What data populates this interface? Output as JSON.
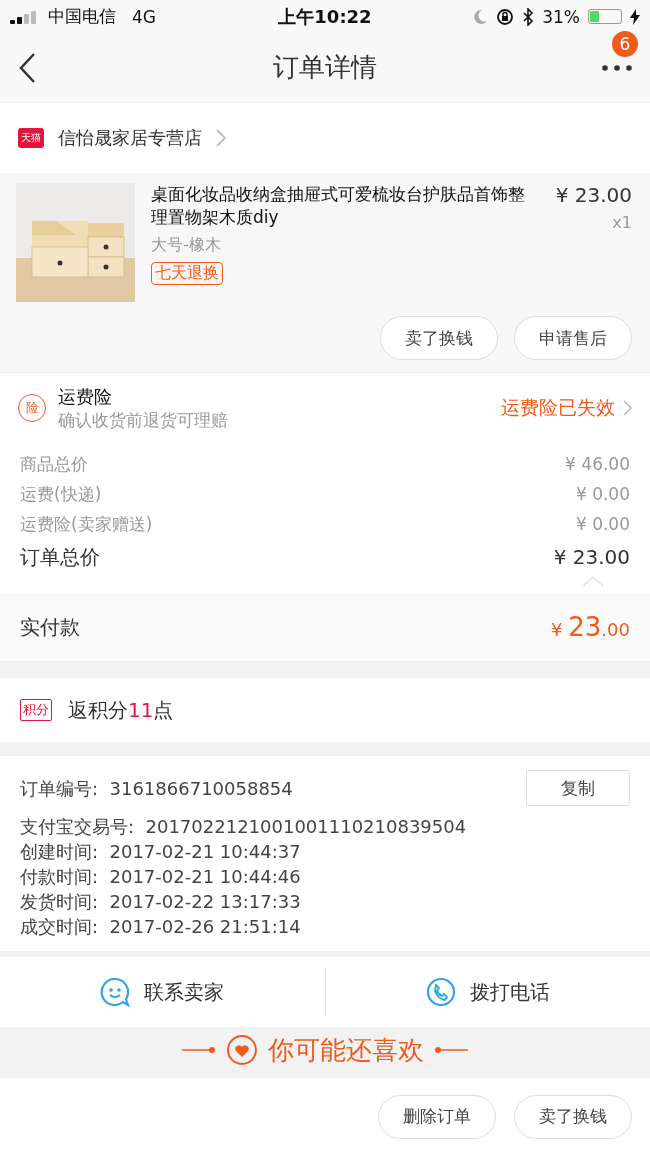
{
  "status_bar": {
    "carrier": "中国电信",
    "network": "4G",
    "time": "上午10:22",
    "battery": "31%"
  },
  "nav": {
    "title": "订单详情",
    "badge": "6"
  },
  "store": {
    "badge": "天猫",
    "name": "信怡晟家居专营店"
  },
  "product": {
    "kind": "picture",
    "title": "桌面化妆品收纳盒抽屉式可爱梳妆台护肤品首饰整理置物架木质diy",
    "variant": "大号-橡木",
    "tag": "七天退换",
    "price": "¥ 23.00",
    "quantity": "x1",
    "buttons": [
      "卖了换钱",
      "申请售后"
    ]
  },
  "insurance": {
    "icon": "险",
    "title": "运费险",
    "subtitle": "确认收货前退货可理赔",
    "status": "运费险已失效"
  },
  "costs": [
    {
      "label": "商品总价",
      "value": "¥ 46.00"
    },
    {
      "label": "运费(快递)",
      "value": "¥ 0.00"
    },
    {
      "label": "运费险(卖家赠送)",
      "value": "¥ 0.00"
    }
  ],
  "total": {
    "label": "订单总价",
    "value": "¥ 23.00"
  },
  "paid": {
    "label": "实付款",
    "currency": "¥",
    "integer": "23",
    "decimal": ".00"
  },
  "points": {
    "badge": "积分",
    "prefix": "返积分",
    "amount": "11",
    "suffix": "点"
  },
  "order_info": {
    "copy_button": "复制",
    "rows": [
      "订单编号:  3161866710058854",
      "支付宝交易号:  2017022121001001110210839504",
      "创建时间:  2017-02-21 10:44:37",
      "付款时间:  2017-02-21 10:44:46",
      "发货时间:  2017-02-22 13:17:33",
      "成交时间:  2017-02-26 21:51:14"
    ]
  },
  "contact": [
    {
      "kind": "chat",
      "label": "联系卖家"
    },
    {
      "kind": "phone",
      "label": "拨打电话"
    }
  ],
  "recommend": {
    "title": "你可能还喜欢"
  },
  "bottom_buttons": [
    "删除订单",
    "卖了换钱"
  ]
}
